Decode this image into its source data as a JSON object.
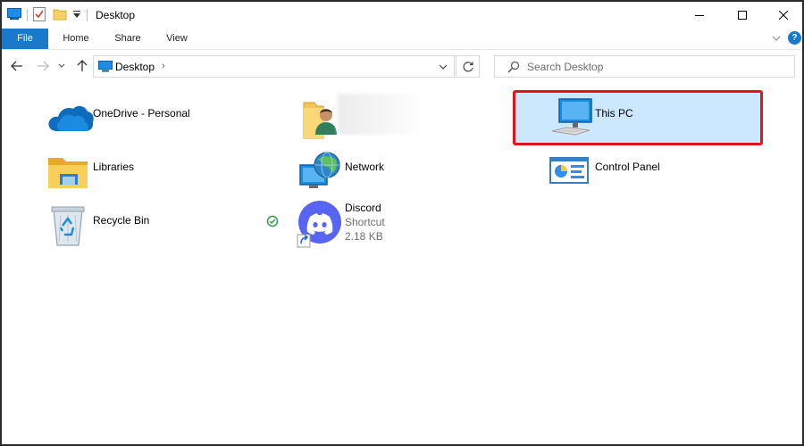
{
  "window": {
    "title": "Desktop"
  },
  "ribbon": {
    "tabs": [
      {
        "label": "File"
      },
      {
        "label": "Home"
      },
      {
        "label": "Share"
      },
      {
        "label": "View"
      }
    ],
    "help_label": "?"
  },
  "nav": {
    "address": {
      "location": "Desktop",
      "chevron": "›"
    },
    "search": {
      "placeholder": "Search Desktop"
    }
  },
  "items": [
    {
      "name": "OneDrive - Personal",
      "icon": "onedrive-cloud-icon"
    },
    {
      "name": "",
      "icon": "user-folder-icon"
    },
    {
      "name": "This PC",
      "icon": "computer-icon",
      "selected": true
    },
    {
      "name": "Libraries",
      "icon": "libraries-folder-icon"
    },
    {
      "name": "Network",
      "icon": "network-globe-icon"
    },
    {
      "name": "Control Panel",
      "icon": "control-panel-icon"
    },
    {
      "name": "Recycle Bin",
      "icon": "recycle-bin-icon",
      "status": "synced"
    },
    {
      "name": "Discord",
      "type": "Shortcut",
      "size": "2.18 KB",
      "icon": "discord-icon"
    }
  ],
  "colors": {
    "accent": "#1979ca",
    "selection": "#cce8ff",
    "highlight": "#e3131b",
    "discord": "#5865f2",
    "sync_ok": "#2f9b48"
  }
}
